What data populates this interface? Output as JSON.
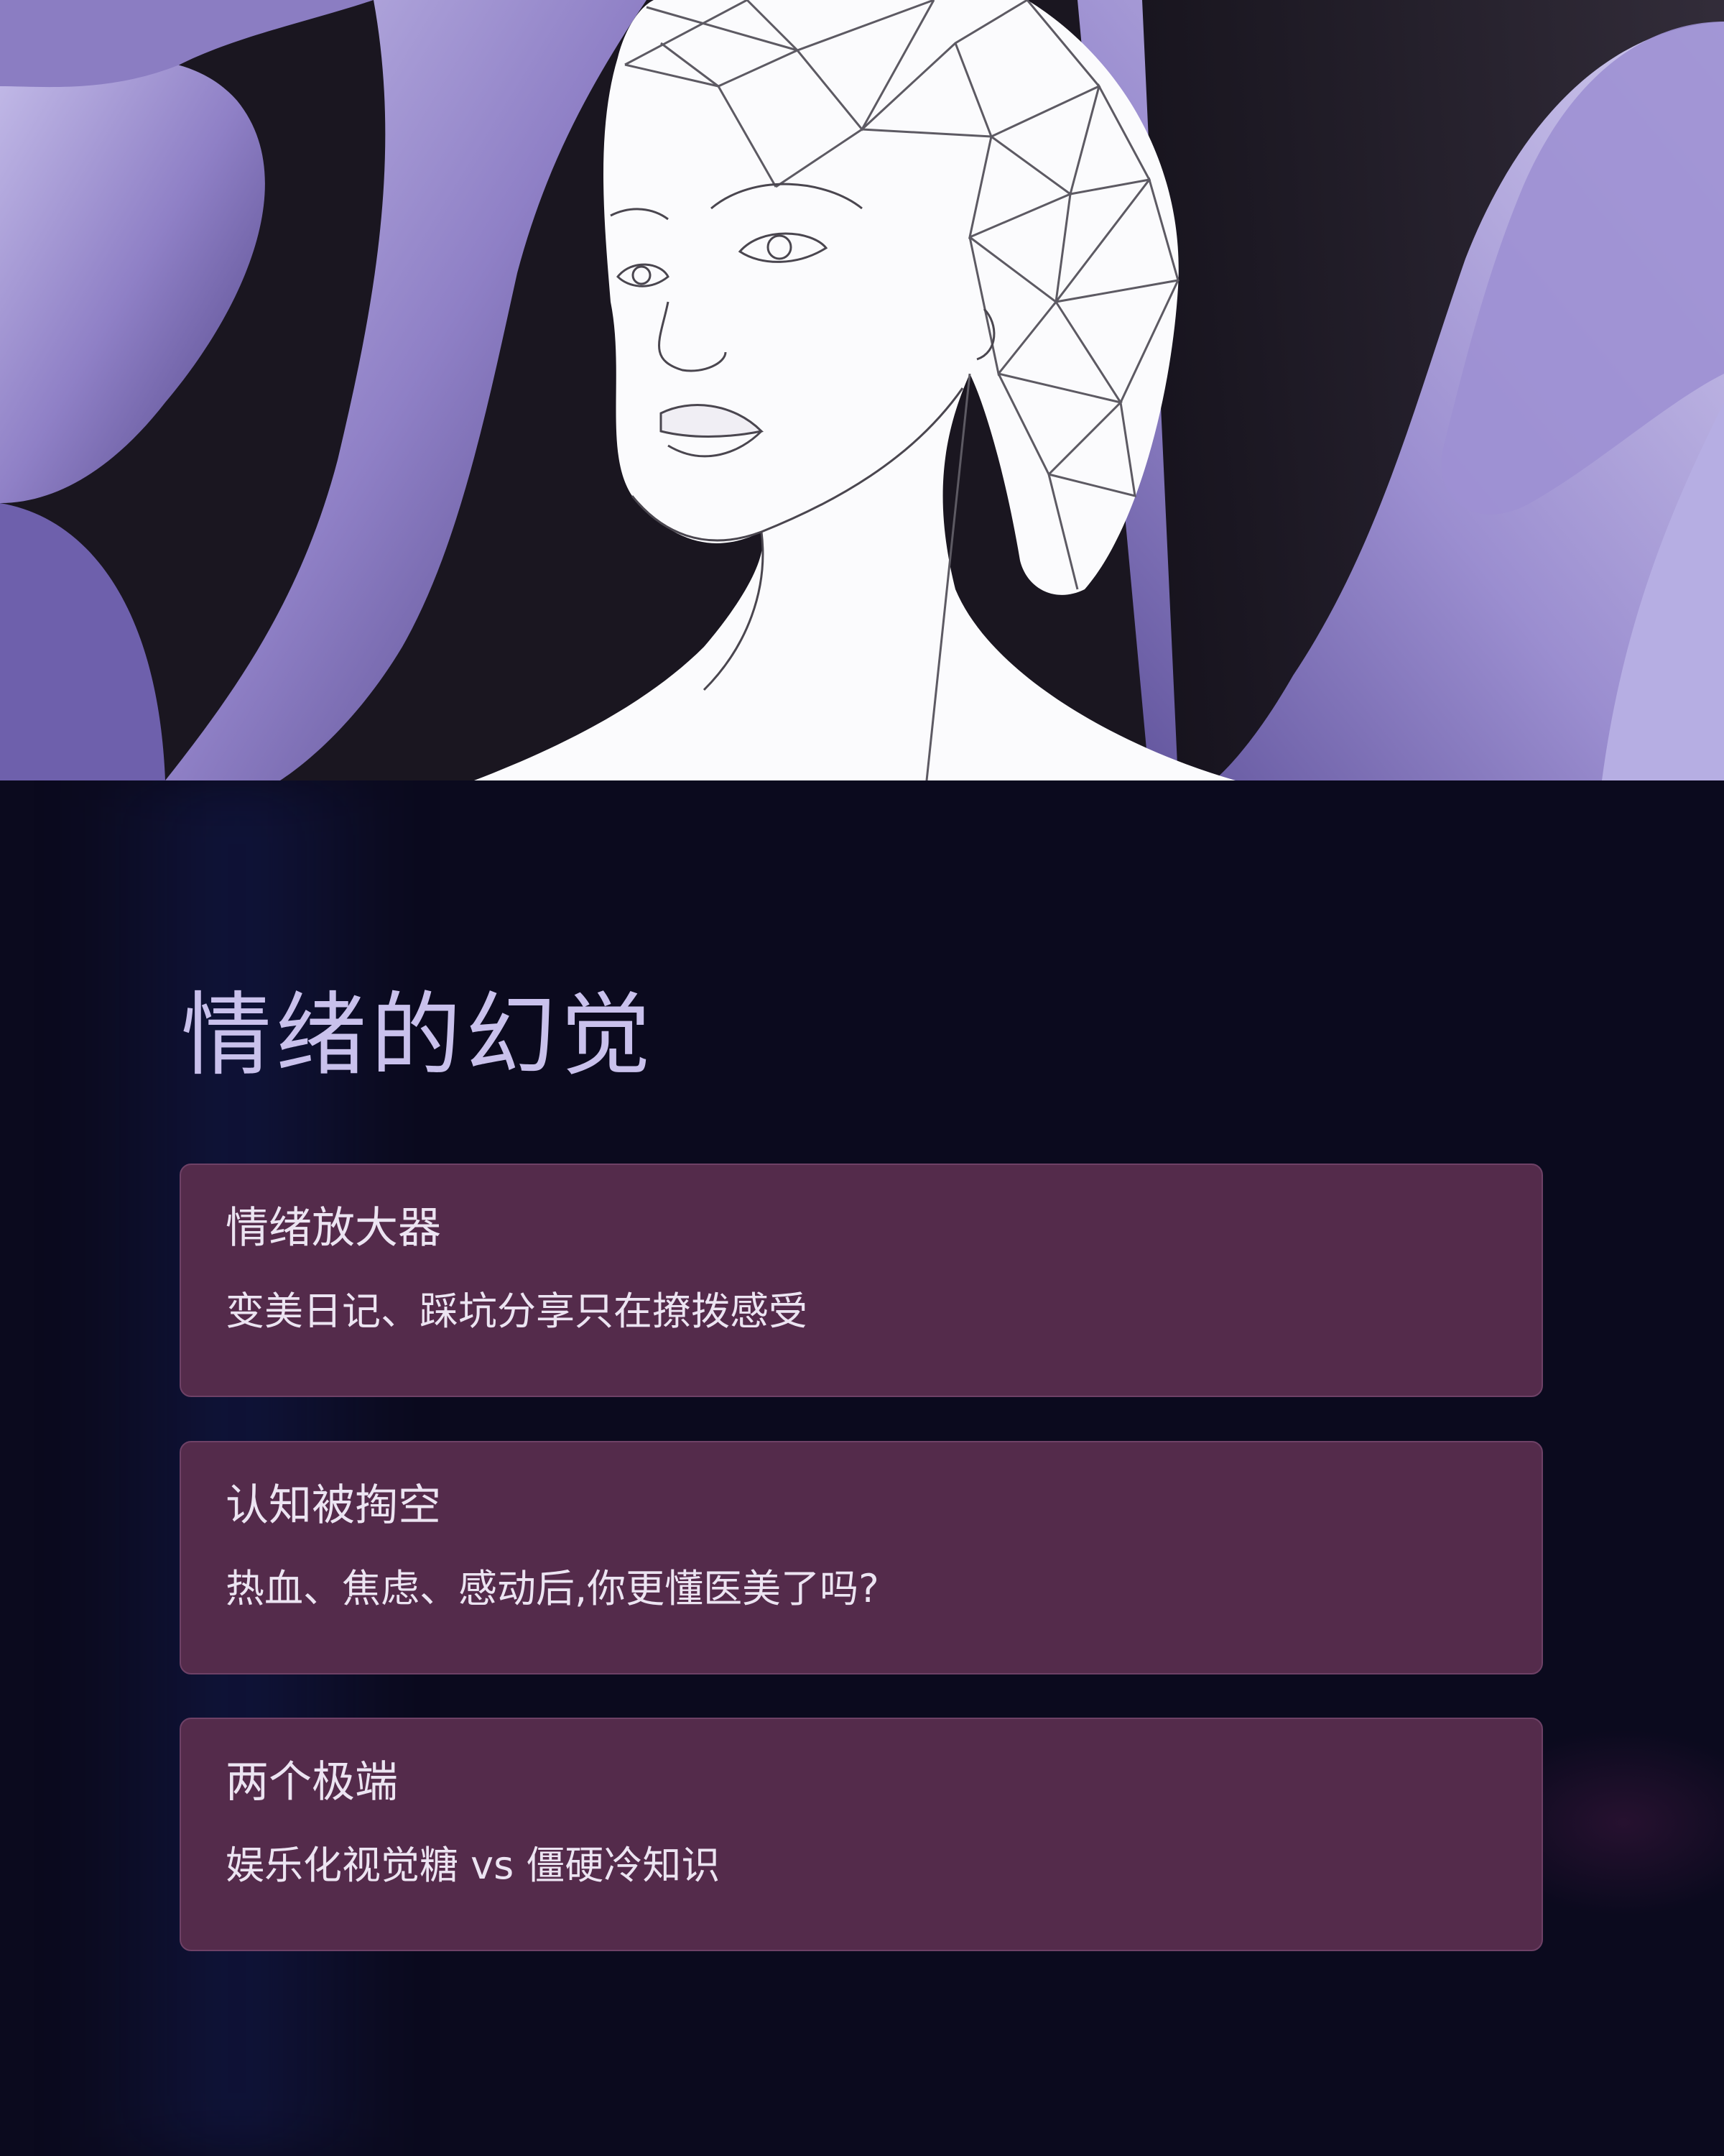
{
  "hero": {
    "illustration": "geometric-line-art-woman-portrait",
    "background_colors": [
      "#b1a7df",
      "#7a6ab0",
      "#1b1722"
    ]
  },
  "main": {
    "title": "情绪的幻觉",
    "cards": [
      {
        "title": "情绪放大器",
        "description": "变美日记、踩坑分享只在撩拨感受"
      },
      {
        "title": "认知被掏空",
        "description": "热血、焦虑、感动后,你更懂医美了吗?"
      },
      {
        "title": "两个极端",
        "description": "娱乐化视觉糖 vs 僵硬冷知识"
      }
    ]
  },
  "colors": {
    "page_background": "#0b0a1e",
    "title_text": "#c9c1ec",
    "card_background": "#542b4b",
    "card_text": "#ece4f2"
  }
}
